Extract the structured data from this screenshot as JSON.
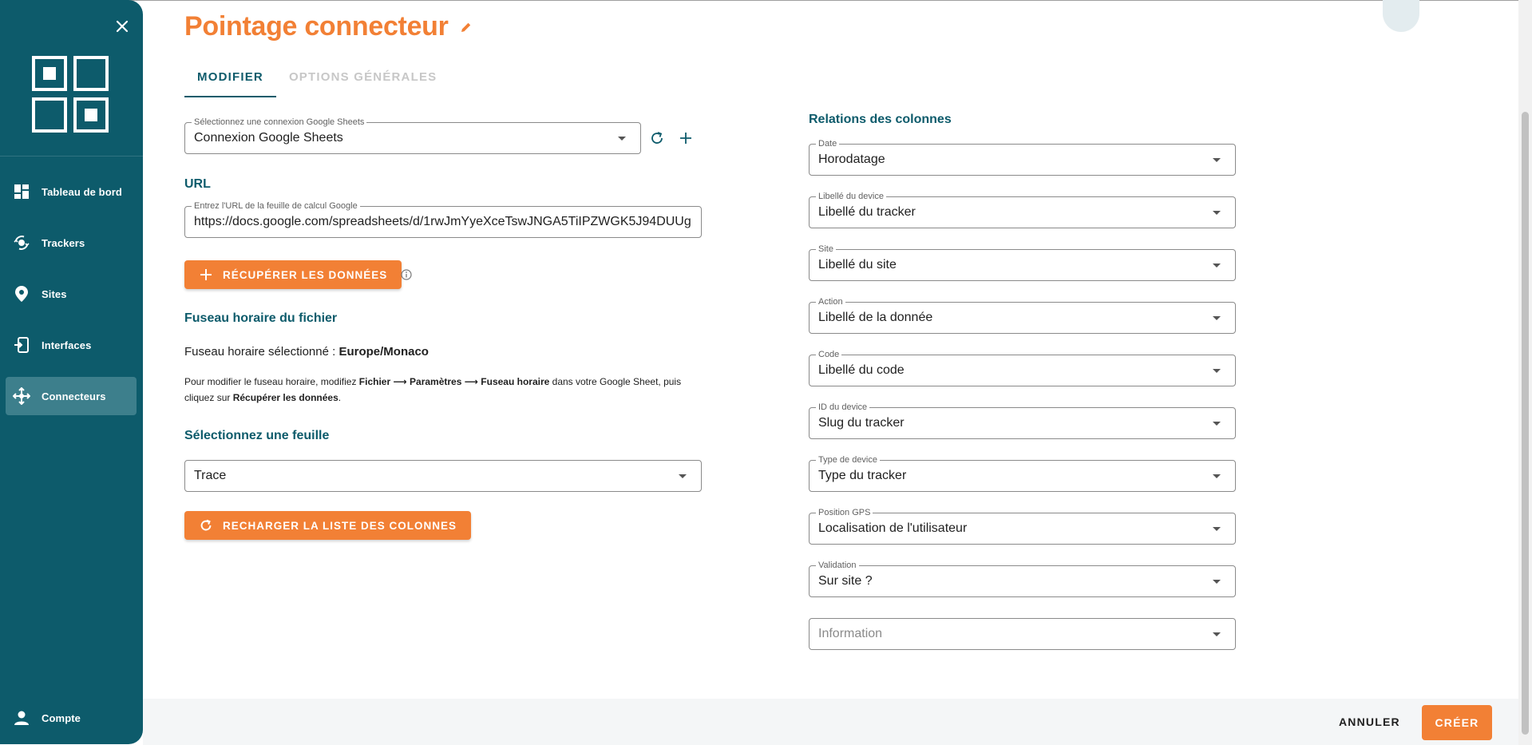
{
  "sidebar": {
    "items": [
      {
        "label": "Tableau de bord",
        "icon": "dashboard-icon"
      },
      {
        "label": "Trackers",
        "icon": "tracker-icon"
      },
      {
        "label": "Sites",
        "icon": "map-pin-icon"
      },
      {
        "label": "Interfaces",
        "icon": "interface-icon"
      },
      {
        "label": "Connecteurs",
        "icon": "connector-icon",
        "active": true
      }
    ],
    "account_label": "Compte"
  },
  "header": {
    "title": "Pointage connecteur"
  },
  "tabs": [
    {
      "label": "MODIFIER",
      "active": true
    },
    {
      "label": "OPTIONS GÉNÉRALES",
      "active": false
    }
  ],
  "connection": {
    "label": "Sélectionnez une connexion Google Sheets",
    "value": "Connexion Google Sheets"
  },
  "url": {
    "section_title": "URL",
    "label": "Entrez l'URL de la feuille de calcul Google",
    "value": "https://docs.google.com/spreadsheets/d/1rwJmYyeXceTswJNGA5TiIPZWGK5J94DUUg"
  },
  "fetch_button": "RÉCUPÉRER LES DONNÉES",
  "timezone": {
    "section_title": "Fuseau horaire du fichier",
    "selected_prefix": "Fuseau horaire sélectionné : ",
    "selected_value": "Europe/Monaco",
    "help_1": "Pour modifier le fuseau horaire, modifiez ",
    "help_fichier": "Fichier",
    "help_arrow1": " ⟶ ",
    "help_parametres": "Paramètres",
    "help_arrow2": " ⟶ ",
    "help_fuseau": "Fuseau horaire",
    "help_2": " dans votre Google Sheet, puis cliquez sur ",
    "help_recuperer": "Récupérer les données",
    "help_3": "."
  },
  "sheet": {
    "section_title": "Sélectionnez une feuille",
    "value": "Trace"
  },
  "reload_button": "RECHARGER LA LISTE DES COLONNES",
  "relations": {
    "title": "Relations des colonnes",
    "fields": [
      {
        "label": "Date",
        "value": "Horodatage"
      },
      {
        "label": "Libellé du device",
        "value": "Libellé du tracker"
      },
      {
        "label": "Site",
        "value": "Libellé du site"
      },
      {
        "label": "Action",
        "value": "Libellé de la donnée"
      },
      {
        "label": "Code",
        "value": "Libellé du code"
      },
      {
        "label": "ID du device",
        "value": "Slug du tracker"
      },
      {
        "label": "Type de device",
        "value": "Type du tracker"
      },
      {
        "label": "Position GPS",
        "value": "Localisation de l'utilisateur"
      },
      {
        "label": "Validation",
        "value": "Sur site ?"
      }
    ],
    "last_placeholder": "Information"
  },
  "footer": {
    "cancel": "ANNULER",
    "create": "CRÉER"
  },
  "colors": {
    "primary": "#0d5b6b",
    "accent": "#f28035"
  }
}
